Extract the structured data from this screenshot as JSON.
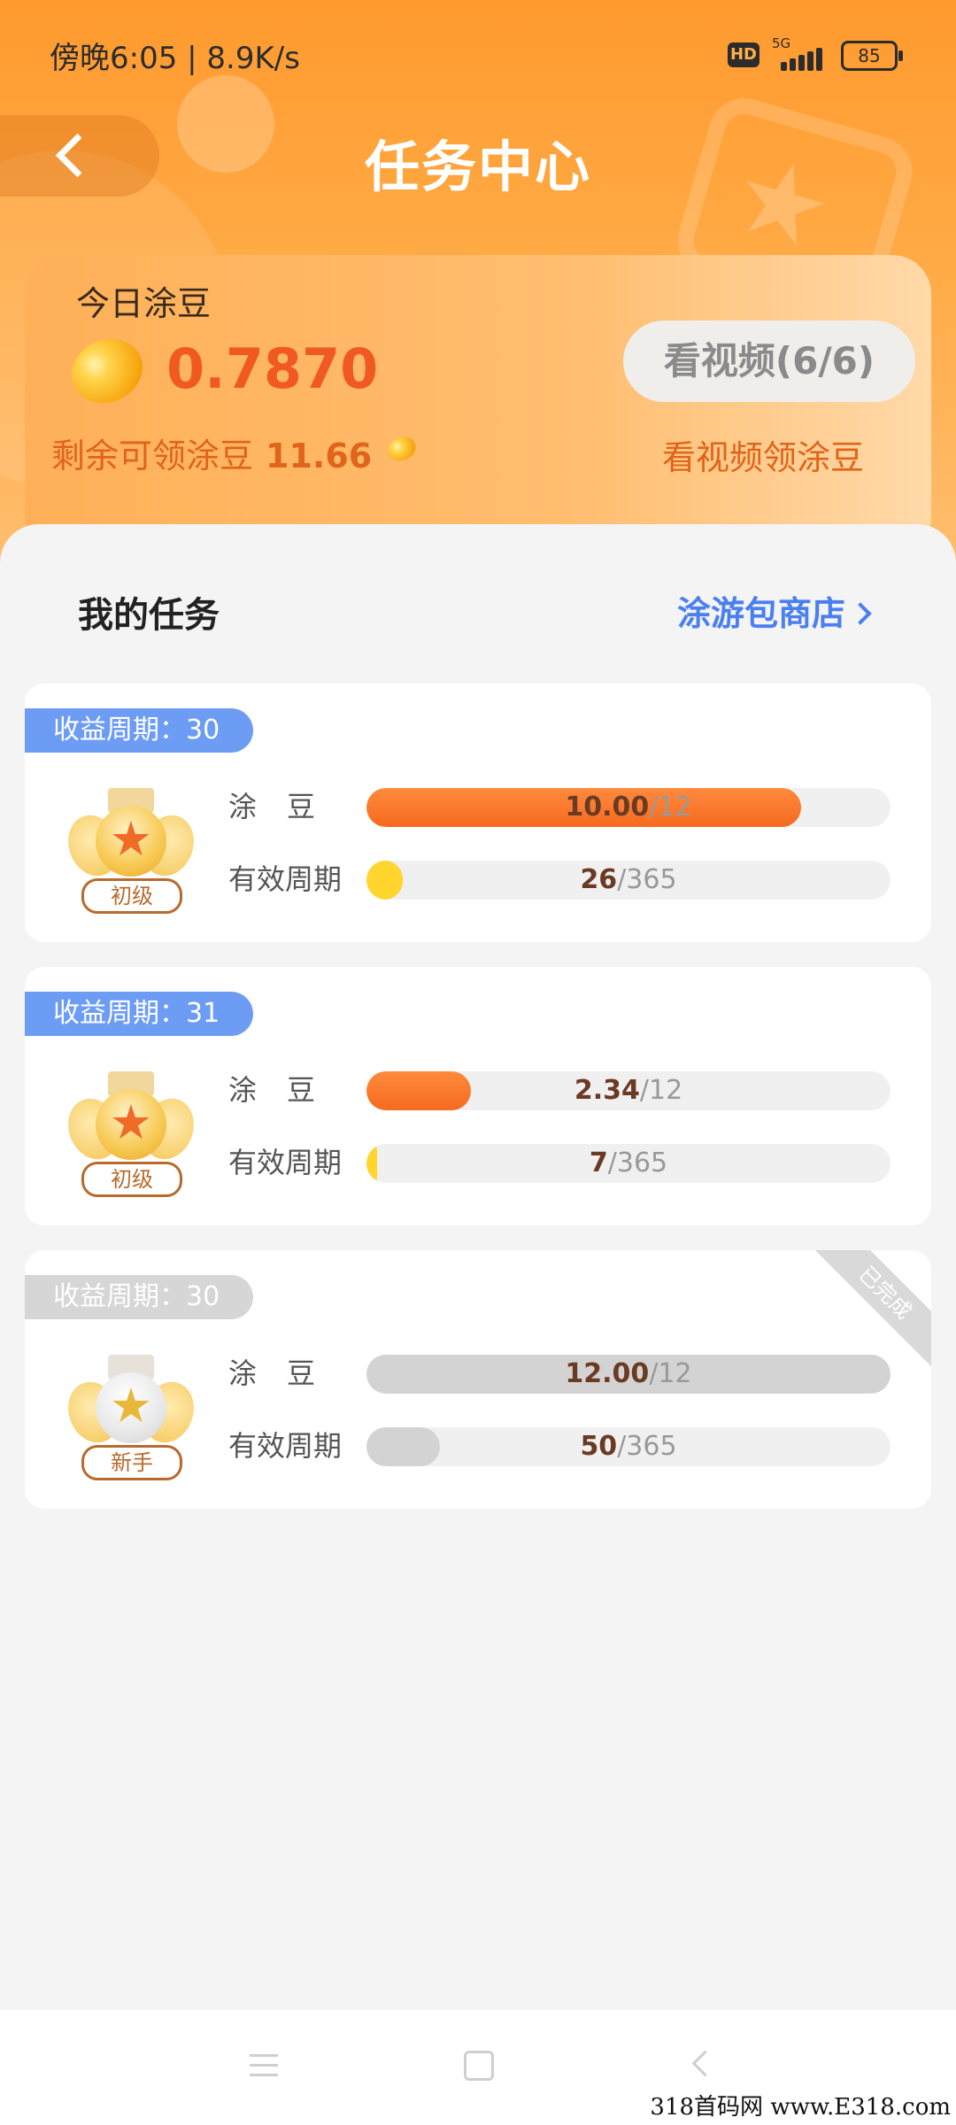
{
  "status_bar": {
    "time": "傍晚6:05 | 8.9K/s",
    "hd": "HD",
    "network": "5G",
    "battery": "85"
  },
  "header": {
    "title": "任务中心"
  },
  "earnings": {
    "label": "今日涂豆",
    "amount": "0.7870",
    "remaining_label": "剩余可领涂豆",
    "remaining_value": "11.66",
    "video_button": "看视频(6/6)",
    "video_link": "看视频领涂豆"
  },
  "section": {
    "title": "我的任务",
    "shop_link": "涂游包商店"
  },
  "tasks": [
    {
      "period_label": "收益周期：30",
      "level": "初级",
      "bean_label": "涂豆",
      "bean_current": "10.00",
      "bean_total": "/12",
      "bean_progress": 0.83,
      "cycle_label": "有效周期",
      "cycle_current": "26",
      "cycle_total": "/365",
      "cycle_progress": 0.07,
      "completed": false
    },
    {
      "period_label": "收益周期：31",
      "level": "初级",
      "bean_label": "涂豆",
      "bean_current": "2.34",
      "bean_total": "/12",
      "bean_progress": 0.2,
      "cycle_label": "有效周期",
      "cycle_current": "7",
      "cycle_total": "/365",
      "cycle_progress": 0.02,
      "completed": false
    },
    {
      "period_label": "收益周期：30",
      "level": "新手",
      "bean_label": "涂豆",
      "bean_current": "12.00",
      "bean_total": "/12",
      "bean_progress": 1.0,
      "cycle_label": "有效周期",
      "cycle_current": "50",
      "cycle_total": "/365",
      "cycle_progress": 0.14,
      "completed": true,
      "completed_label": "已完成"
    }
  ],
  "watermark": "318首码网 www.E318.com",
  "colors": {
    "header_orange": "#ff9a2e",
    "amount_red": "#f05a22",
    "link_blue": "#4a7ff0",
    "tag_blue": "#6d9cf5",
    "progress_orange": "#f56a1f",
    "progress_yellow": "#ffd52e"
  }
}
